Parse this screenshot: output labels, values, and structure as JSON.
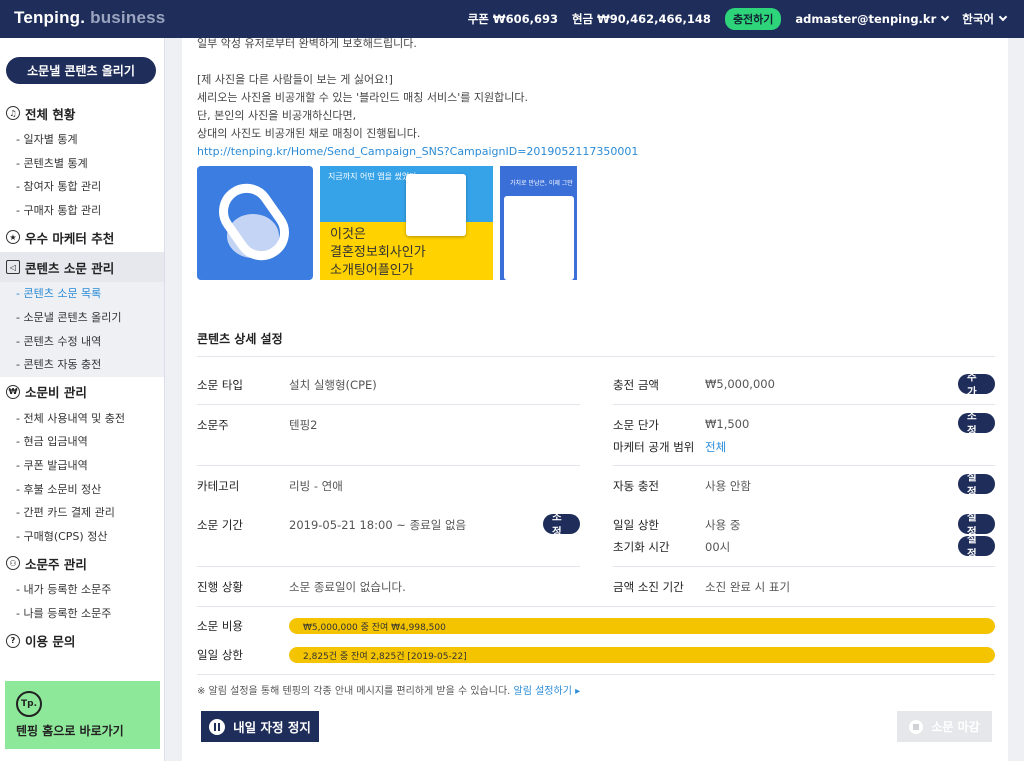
{
  "header": {
    "logo_main": "Tenping.",
    "logo_sub": "business",
    "coupon": "쿠폰 ₩606,693",
    "cash": "현금 ₩90,462,466,148",
    "charge_label": "충전하기",
    "account": "admaster@tenping.kr",
    "language": "한국어"
  },
  "sidebar": {
    "upload_label": "소문낼 콘텐츠 올리기",
    "sections": [
      {
        "label": "전체 현황",
        "icon": "headset-icon",
        "items": [
          "일자별 통계",
          "콘텐츠별 통계",
          "참여자 통합 관리",
          "구매자 통합 관리"
        ]
      },
      {
        "label": "우수 마케터 추천",
        "icon": "star-icon",
        "items": []
      },
      {
        "label": "콘텐츠 소문 관리",
        "icon": "megaphone-icon",
        "items": [
          "콘텐츠 소문 목록",
          "소문낼 콘텐츠 올리기",
          "콘텐츠 수정 내역",
          "콘텐츠 자동 충전"
        ]
      },
      {
        "label": "소문비 관리",
        "icon": "won-icon",
        "items": [
          "전체 사용내역 및 충전",
          "현금 입금내역",
          "쿠폰 발급내역",
          "후불 소문비 정산",
          "간편 카드 결제 관리",
          "구매형(CPS) 정산"
        ]
      },
      {
        "label": "소문주 관리",
        "icon": "user-icon",
        "items": [
          "내가 등록한 소문주",
          "나를 등록한 소문주"
        ]
      },
      {
        "label": "이용 문의",
        "icon": "question-icon",
        "items": []
      }
    ],
    "home_badge": "Tp.",
    "home_label": "텐핑 홈으로 바로가기"
  },
  "intro": {
    "line0": "일부 악성 유저로부터 완벽하게 보호해드립니다.",
    "line1": "[제 사진을 다른 사람들이 보는 게 싫어요!]",
    "line2": "세리오는 사진을 비공개할 수 있는 '블라인드 매칭 서비스'를 지원합니다.",
    "line3": "단, 본인의 사진을 비공개하신다면,",
    "line4": "상대의 사진도 비공개된 채로 매칭이 진행됩니다.",
    "url": "http://tenping.kr/Home/Send_Campaign_SNS?CampaignID=2019052117350001"
  },
  "images": {
    "img2_small": "지금까지 어떤 앱을 썼었다",
    "img2_text1": "이것은",
    "img2_text2": "결혼정보회사인가",
    "img2_text3": "소개팅어플인가",
    "img3_small": "가치로 만남은, 이제 그만"
  },
  "detail": {
    "title": "콘텐츠 상세 설정",
    "type_label": "소문 타입",
    "type_value": "설치 실행형(CPE)",
    "owner_label": "소문주",
    "owner_value": "텐핑2",
    "category_label": "카테고리",
    "category_value": "리빙 - 연애",
    "period_label": "소문 기간",
    "period_value": "2019-05-21 18:00 ~ 종료일 없음",
    "period_btn": "조정",
    "progress_label": "진행 상황",
    "progress_value": "소문 종료일이 없습니다.",
    "charge_label": "충전 금액",
    "charge_value": "₩5,000,000",
    "charge_btn": "추가",
    "unit_label": "소문 단가",
    "unit_value": "₩1,500",
    "unit_btn": "조정",
    "scope_label": "마케터 공개 범위",
    "scope_value": "전체",
    "auto_label": "자동 충전",
    "auto_value": "사용 안함",
    "auto_btn": "설정",
    "daily_label": "일일 상한",
    "daily_value": "사용 중",
    "daily_btn": "설정",
    "reset_label": "초기화 시간",
    "reset_value": "00시",
    "reset_btn": "설정",
    "exhaust_label": "금액 소진 기간",
    "exhaust_value": "소진 완료 시 표기",
    "cost_label": "소문 비용",
    "cost_bar": "₩5,000,000 중 잔여 ₩4,998,500",
    "cost_fill": 0.9997,
    "limit_label": "일일 상한",
    "limit_bar": "2,825건 중 잔여 2,825건 [2019-05-22]",
    "limit_fill": 1.0
  },
  "footer": {
    "note": "※ 알림 설정을 통해 텐핑의 각종 안내 메시지를 편리하게 받을 수 있습니다.",
    "note_link": "알림 설정하기 ▸",
    "pause_label": "내일 자정 정지",
    "end_label": "소문 마감"
  }
}
